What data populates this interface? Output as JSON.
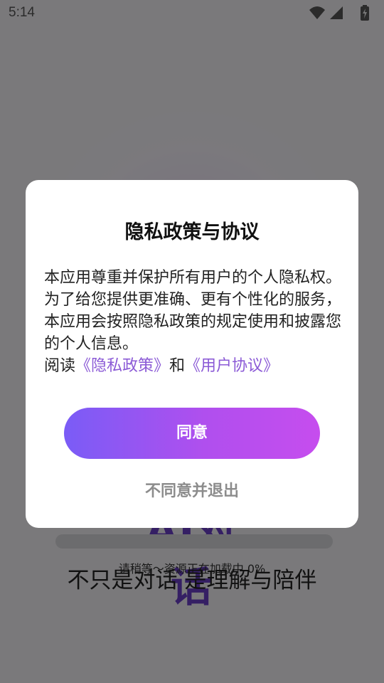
{
  "status_bar": {
    "time": "5:14",
    "icons": [
      "wifi-icon",
      "cellular-signal-icon",
      "battery-charging-icon"
    ]
  },
  "splash": {
    "logo_text": "AI对话",
    "loading_progress_percent": 0,
    "loading_text": "请稍等～资源正在加载中 0%",
    "slogan": "不只是对话 是理解与陪伴"
  },
  "dialog": {
    "title": "隐私政策与协议",
    "body_text": "本应用尊重并保护所有用户的个人隐私权。为了给您提供更准确、更有个性化的服务， 本应用会按照隐私政策的规定使用和披露您的个人信息。",
    "read_prefix": "阅读",
    "privacy_link": "《隐私政策》",
    "and_text": "和",
    "terms_link": "《用户协议》",
    "agree_label": "同意",
    "disagree_label": "不同意并退出"
  },
  "colors": {
    "accent_start": "#7a5cf6",
    "accent_end": "#c64dee",
    "link": "#8b5ad6"
  }
}
